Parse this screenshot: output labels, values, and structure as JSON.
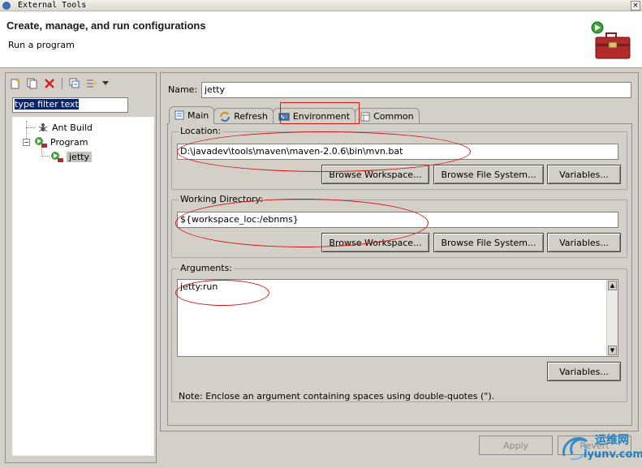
{
  "window": {
    "title": "External Tools",
    "close_glyph": "×"
  },
  "banner": {
    "heading": "Create, manage, and run configurations",
    "subtitle": "Run a program"
  },
  "left_panel": {
    "toolbar_icons": [
      "new-configuration-icon",
      "duplicate-icon",
      "delete-icon",
      "collapse-all-icon",
      "filter-icon",
      "dropdown-arrow-icon"
    ],
    "filter_text": "type filter text",
    "tree": {
      "ant_build": "Ant Build",
      "program": "Program",
      "jetty": "jetty"
    }
  },
  "main": {
    "name_label": "Name:",
    "name_value": "jetty",
    "tabs": [
      {
        "label": "Main",
        "icon": "main-tab-icon",
        "active": true
      },
      {
        "label": "Refresh",
        "icon": "refresh-icon",
        "active": false
      },
      {
        "label": "Environment",
        "icon": "environment-icon",
        "active": false
      },
      {
        "label": "Common",
        "icon": "common-icon",
        "active": false
      }
    ],
    "location": {
      "label": "Location:",
      "value": "D:\\javadev\\tools\\maven\\maven-2.0.6\\bin\\mvn.bat",
      "browse_workspace": "Browse Workspace...",
      "browse_fs": "Browse File System...",
      "variables": "Variables..."
    },
    "working_dir": {
      "label": "Working Directory:",
      "value": "${workspace_loc:/ebnms}",
      "browse_workspace": "Browse Workspace...",
      "browse_fs": "Browse File System...",
      "variables": "Variables..."
    },
    "arguments": {
      "label": "Arguments:",
      "value": "jetty:run",
      "variables": "Variables...",
      "note": "Note: Enclose an argument containing spaces using double-quotes (\")."
    }
  },
  "footer": {
    "apply": "Apply",
    "revert": "Revert"
  },
  "watermark": {
    "top": "运维网",
    "bottom": "iyunv.com"
  },
  "colors": {
    "annotation_red": "#d01818",
    "selection_blue": "#0a246a",
    "watermark_blue": "#1c80c4"
  }
}
